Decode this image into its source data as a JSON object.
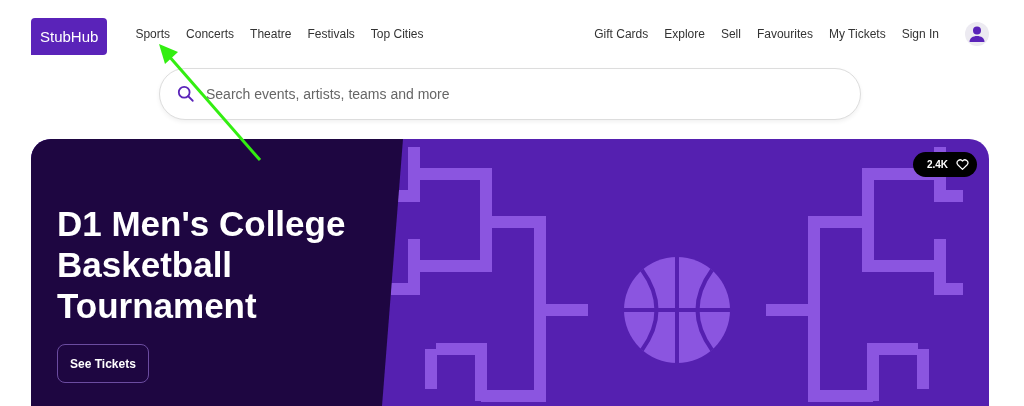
{
  "header": {
    "logo": "StubHub",
    "nav_left": [
      {
        "label": "Sports"
      },
      {
        "label": "Concerts"
      },
      {
        "label": "Theatre"
      },
      {
        "label": "Festivals"
      },
      {
        "label": "Top Cities"
      }
    ],
    "nav_right": [
      {
        "label": "Gift Cards"
      },
      {
        "label": "Explore"
      },
      {
        "label": "Sell"
      },
      {
        "label": "Favourites"
      },
      {
        "label": "My Tickets"
      },
      {
        "label": "Sign In"
      }
    ]
  },
  "search": {
    "placeholder": "Search events, artists, teams and more"
  },
  "hero": {
    "title": "D1 Men's College Basketball Tournament",
    "button": "See Tickets",
    "likes": "2.4K",
    "liked": false
  },
  "annotation": {
    "kind": "arrow",
    "color": "#33ee11"
  }
}
